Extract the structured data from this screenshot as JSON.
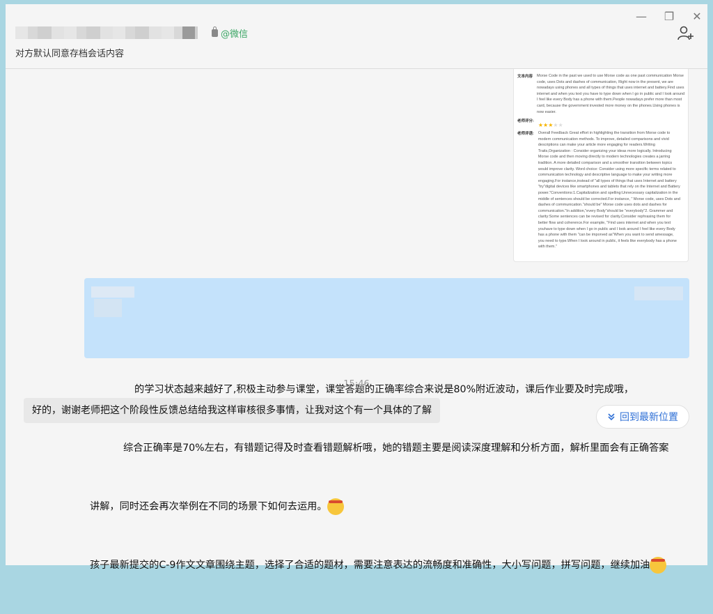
{
  "header": {
    "source_tag": "@微信",
    "subtitle": "对方默认同意存档会话内容",
    "minimize_label": "—",
    "restore_label": "❐",
    "close_label": "✕"
  },
  "doc_card": {
    "content_label": "文本内容",
    "content_text": "Morse Code in the past we used to use Morse code as one past communication Morse code, uses Dots and dashes of communication, Right now in the present, we are nowadays using phones and all types of things that uses internet and battery.Find uses internet and when you text you have to type down when I go in public and I look around I feel like every Body has a phone with them.People nowadays prefer more than most card, because the government invested more money on the phones.Using phones is now easier.",
    "rating_label": "老师评分:",
    "rating": 3,
    "rating_max": 5,
    "comment_label": "老师评语:",
    "comment_text": "Overall Feedback Great effort in highlighting the transition from Morse code to modern communication methods. To improve, detailed comparisons and vivid descriptions can make your article more engaging for readers.Writing Traits,Organization : Consider organizing your ideas more logically. Introducing Morse code and then moving directly to modern technologies creates a jarring tradition. A more detailed comparison and a smoother transition between topics would improve clarity. Word choice: Consider using more specific terms related to communication technology and descriptive language to make your writing more engaging.For instance,instead of \"all types of things that uses Internet and battery \"try\"digital devices like smartphones and tablets that rely on the Internet and Battery power.\"Conventions:1.Capitalization and spelling:Unnecessary capitalization in the middle of sentences should be corrected.For instance, \" Morse code, uses Dots and dashes of communication.\"should be\" Morse code uses dots and dashes for communication.\"In addition,\"every Body\"should be \"everybody\"2. Grammer and clarity:Some sentences can be revised for clarity.Consider rephrasing them for better flow and coherence.For example, \"Find uses internet and when you text youhave to type down when I go in public and I look around I feel like every Body has a phone with them \"can be imporved as\"When you want to send amessage, you need to type.When I look around in public, it feels like everybody has a phone with them.\""
  },
  "messages": {
    "outgoing_line1": "的学习状态越来越好了,积极主动参与课堂，课堂答题的正确率综合来说是80%附近波动，课后作业要及时完成哦，",
    "outgoing_line2": "综合正确率是70%左右，有错题记得及时查看错题解析哦，她的错题主要是阅读深度理解和分析方面，解析里面会有正确答案",
    "outgoing_line3": "讲解，同时还会再次举例在不同的场景下如何去运用。",
    "outgoing_line4": "孩子最新提交的C-9作文文章围绕主题，选择了合适的题材，需要注意表达的流畅度和准确性，大小写问题，拼写问题，继续加油",
    "timestamp": "15:46",
    "incoming": "好的，谢谢老师把这个阶段性反馈总结给我这样审核很多事情，让我对这个有一个具体的了解"
  },
  "jump_button": {
    "label": "回到最新位置"
  },
  "icons": {
    "lock": "lock-icon",
    "add_user": "add-user-icon",
    "emoji": "hardworking-emoji-icon",
    "chevrons": "double-chevron-down-icon"
  }
}
